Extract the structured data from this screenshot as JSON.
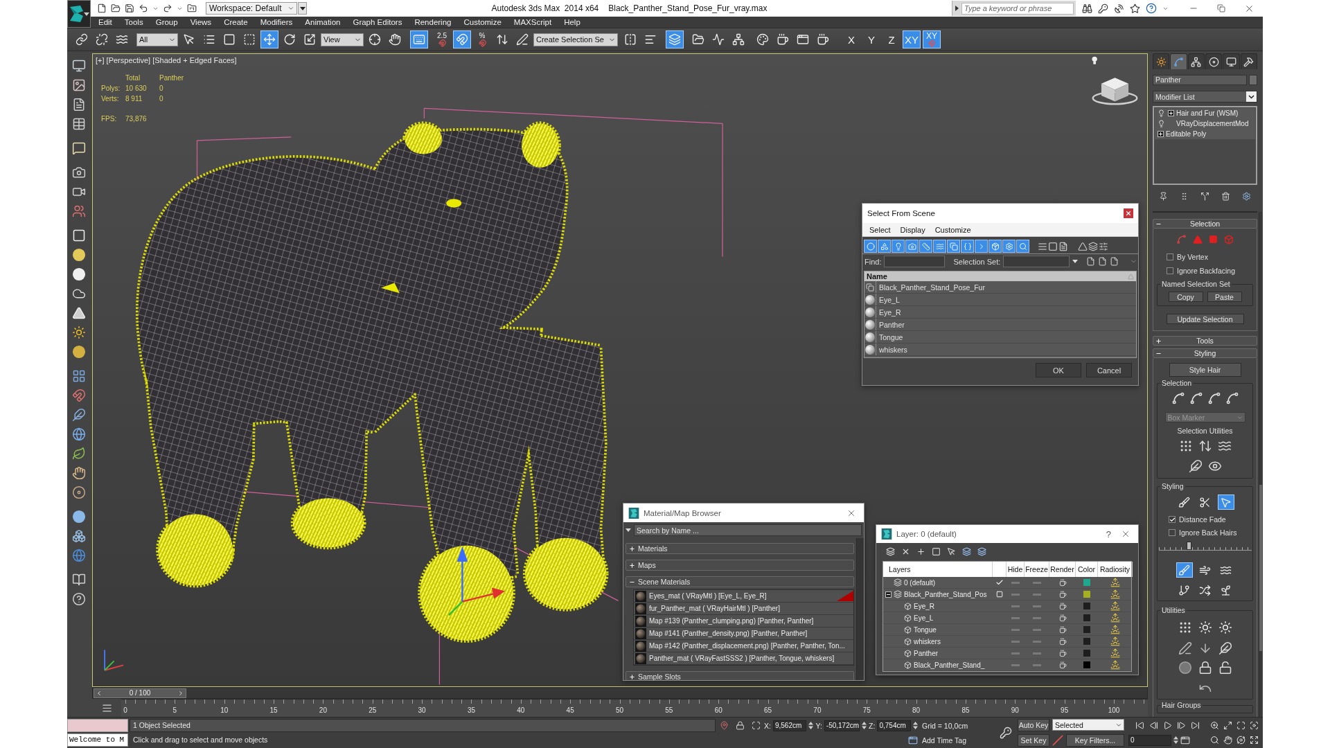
{
  "title_bar": {
    "workspace": "Workspace: Default",
    "app_name": "Autodesk 3ds Max  2014 x64",
    "file_name": "Black_Panther_Stand_Pose_Fur_vray.max",
    "search": {
      "placeholder": "Type a keyword or phrase"
    }
  },
  "menu": [
    "Edit",
    "Tools",
    "Group",
    "Views",
    "Create",
    "Modifiers",
    "Animation",
    "Graph Editors",
    "Rendering",
    "Customize",
    "MAXScript",
    "Help"
  ],
  "main_toolbar": [
    {
      "kind": "button",
      "on": false
    },
    {
      "kind": "button",
      "on": false
    },
    {
      "kind": "button",
      "on": false
    },
    {
      "kind": "dropdown",
      "value": "All"
    },
    {
      "kind": "button",
      "on": false
    },
    {
      "kind": "button",
      "on": false
    },
    {
      "kind": "button",
      "on": false
    },
    {
      "kind": "button",
      "on": false
    },
    {
      "kind": "button",
      "on": true
    },
    {
      "kind": "button",
      "on": false
    },
    {
      "kind": "button",
      "on": false
    },
    {
      "kind": "dropdown",
      "value": "View"
    },
    {
      "kind": "button",
      "on": false
    },
    {
      "kind": "button",
      "on": false
    },
    {
      "kind": "button",
      "on": true
    },
    {
      "kind": "snap",
      "label": "2.5",
      "on": false
    },
    {
      "kind": "button",
      "on": true
    },
    {
      "kind": "snap",
      "label": "%",
      "on": false
    },
    {
      "kind": "button",
      "on": false
    },
    {
      "kind": "button",
      "on": false
    },
    {
      "kind": "dropdown",
      "value": "Create Selection Se"
    },
    {
      "kind": "button",
      "on": false
    },
    {
      "kind": "button",
      "on": false
    },
    {
      "kind": "button",
      "on": true
    },
    {
      "kind": "button",
      "on": false
    },
    {
      "kind": "button",
      "on": false
    },
    {
      "kind": "button",
      "on": false
    },
    {
      "kind": "button",
      "on": false
    },
    {
      "kind": "button",
      "on": false
    },
    {
      "kind": "button",
      "on": false
    },
    {
      "kind": "button",
      "on": false
    },
    {
      "kind": "axis",
      "label": "X",
      "on": false
    },
    {
      "kind": "axis",
      "label": "Y",
      "on": false
    },
    {
      "kind": "axis",
      "label": "Z",
      "on": false
    },
    {
      "kind": "axis",
      "label": "XY",
      "on": true
    },
    {
      "kind": "snap_axis",
      "label": "XY",
      "on": true
    }
  ],
  "viewport": {
    "label": "[+] [Perspective] [Shaded + Edged Faces]",
    "stats": {
      "header": [
        "Total",
        "Panther"
      ],
      "rows": [
        {
          "label": "Polys:",
          "values": [
            "10 630",
            "0"
          ]
        },
        {
          "label": "Verts:",
          "values": [
            "8 911",
            "0"
          ]
        }
      ],
      "fps": {
        "label": "FPS:",
        "value": "73,876"
      }
    }
  },
  "select_from_scene": {
    "title": "Select From Scene",
    "menu": [
      "Select",
      "Display",
      "Customize"
    ],
    "filters": [
      {
        "on": true
      },
      {
        "on": true
      },
      {
        "on": true
      },
      {
        "on": true
      },
      {
        "on": true
      },
      {
        "on": true
      },
      {
        "on": true
      },
      {
        "on": true
      },
      {
        "on": true
      },
      {
        "on": true
      },
      {
        "on": true
      },
      {
        "on": true
      }
    ],
    "find": {
      "label": "Find:"
    },
    "selection_set": {
      "label": "Selection Set:"
    },
    "column": "Name",
    "rows": [
      {
        "name": "Black_Panther_Stand_Pose_Fur",
        "kind": "group"
      },
      {
        "name": "Eye_L",
        "kind": "geometry"
      },
      {
        "name": "Eye_R",
        "kind": "geometry"
      },
      {
        "name": "Panther",
        "kind": "geometry"
      },
      {
        "name": "Tongue",
        "kind": "geometry"
      },
      {
        "name": "whiskers",
        "kind": "geometry"
      }
    ],
    "buttons": [
      "OK",
      "Cancel"
    ]
  },
  "material_browser": {
    "title": "Material/Map Browser",
    "search": {
      "placeholder": "Search by Name ..."
    },
    "groups": [
      {
        "label": "Materials",
        "expanded": false
      },
      {
        "label": "Maps",
        "expanded": false
      },
      {
        "label": "Scene Materials",
        "expanded": true,
        "items": [
          {
            "name": "Eyes_mat ( VRayMtl ) [Eye_L, Eye_R]",
            "flagged": true
          },
          {
            "name": "fur_Panther_mat ( VRayHairMtl ) [Panther]",
            "flagged": false
          },
          {
            "name": "Map #139 (Panther_clumping.png) [Panther, Panther]",
            "flagged": false
          },
          {
            "name": "Map #141 (Panther_density.png) [Panther, Panther]",
            "flagged": false
          },
          {
            "name": "Map #142 (Panther_displacement.png) [Panther, Panther, Ton...",
            "flagged": false
          },
          {
            "name": "Panther_mat ( VRayFastSSS2 ) [Panther, Tongue, whiskers]",
            "flagged": false
          }
        ]
      },
      {
        "label": "Sample Slots",
        "expanded": false
      }
    ]
  },
  "layer_manager": {
    "title": "Layer: 0 (default)",
    "help": "?",
    "columns": [
      "Layers",
      "Hide",
      "Freeze",
      "Render",
      "Color",
      "Radiosity"
    ],
    "layers": [
      {
        "name": "0 (default)",
        "current": true,
        "color": "#20a88f"
      },
      {
        "name": "Black_Panther_Stand_Pos",
        "current": false,
        "color": "#a4b020",
        "expanded": true,
        "children": [
          {
            "name": "Eye_R",
            "color": "#1e1e1e"
          },
          {
            "name": "Eye_L",
            "color": "#1e1e1e"
          },
          {
            "name": "Tongue",
            "color": "#1e1e1e"
          },
          {
            "name": "whiskers",
            "color": "#1e1e1e"
          },
          {
            "name": "Panther",
            "color": "#1e1e1e"
          },
          {
            "name": "Black_Panther_Stand_",
            "color": "#000000"
          }
        ]
      }
    ]
  },
  "command_panel": {
    "tabs": [
      {
        "selected": false
      },
      {
        "selected": true
      },
      {
        "selected": false
      },
      {
        "selected": false
      },
      {
        "selected": false
      },
      {
        "selected": false
      }
    ],
    "object_name": {
      "value": "Panther"
    },
    "modifier_list": "Modifier List",
    "stack": [
      {
        "name": "Hair and Fur (WSM)",
        "kind": "modifier",
        "expandable": true
      },
      {
        "name": "VRayDisplacementMod",
        "kind": "modifier",
        "expandable": false
      },
      {
        "name": "Editable Poly",
        "kind": "base",
        "expandable": true
      }
    ],
    "selection_rollout": {
      "title": "Selection",
      "expanded": true,
      "checkboxes": [
        {
          "label": "By Vertex",
          "checked": false
        },
        {
          "label": "Ignore Backfacing",
          "checked": false
        }
      ],
      "named_set": {
        "title": "Named Selection Set",
        "buttons": [
          "Copy",
          "Paste"
        ]
      },
      "update_button": "Update Selection"
    },
    "tools_rollout": {
      "title": "Tools",
      "expanded": false
    },
    "styling_rollout": {
      "title": "Styling",
      "expanded": true,
      "style_button": "Style Hair",
      "selection_group": {
        "title": "Selection",
        "dropdown": {
          "value": "Box Marker",
          "disabled": true
        },
        "utilities_label": "Selection Utilities"
      },
      "styling_group": {
        "title": "Styling",
        "tools": [
          {
            "selected": false
          },
          {
            "selected": false
          },
          {
            "selected": true
          }
        ],
        "checkboxes": [
          {
            "label": "Distance Fade",
            "checked": true
          },
          {
            "label": "Ignore Back Hairs",
            "checked": false
          }
        ],
        "slider": {
          "level": 0.32
        },
        "brushes": [
          {
            "selected": true
          },
          {
            "selected": false
          },
          {
            "selected": false
          },
          {
            "selected": false
          },
          {
            "selected": false
          },
          {
            "selected": false
          }
        ]
      },
      "utilities_group": {
        "title": "Utilities"
      },
      "hair_groups_group": {
        "title": "Hair Groups"
      }
    }
  },
  "timeline": {
    "slider": {
      "label": "0 / 100",
      "level": 0
    },
    "frames": [
      "0",
      "5",
      "10",
      "15",
      "20",
      "25",
      "30",
      "35",
      "40",
      "45",
      "50",
      "55",
      "60",
      "65",
      "70",
      "75",
      "80",
      "85",
      "90",
      "95",
      "100"
    ]
  },
  "status_bar": {
    "listener": "Welcome to M",
    "selection": "1 Object Selected",
    "prompt": "Click and drag to select and move objects",
    "coords": [
      {
        "label": "X:",
        "value": "9,562cm"
      },
      {
        "label": "Y:",
        "value": "-50,172cm"
      },
      {
        "label": "Z:",
        "value": "0,754cm"
      }
    ],
    "grid": "Grid = 10,0cm",
    "time_tag": "Add Time Tag",
    "auto_key": {
      "label": "Auto Key",
      "on": false
    },
    "set_key": "Set Key",
    "key_mode": "Selected",
    "key_filters": "Key Filters...",
    "frame": "0"
  }
}
